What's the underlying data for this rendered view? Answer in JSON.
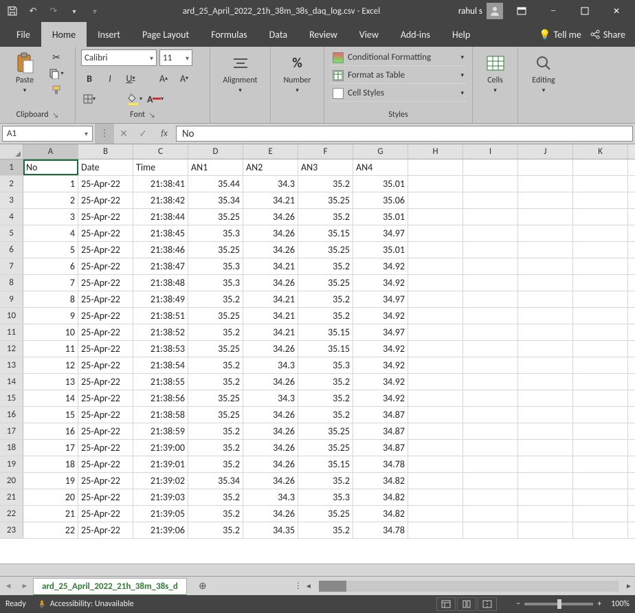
{
  "title": "ard_25_April_2022_21h_38m_38s_daq_log.csv - Excel",
  "user": "rahul s",
  "tabs": [
    "File",
    "Home",
    "Insert",
    "Page Layout",
    "Formulas",
    "Data",
    "Review",
    "View",
    "Add-ins",
    "Help"
  ],
  "tellme": "Tell me",
  "share": "Share",
  "clipboard": {
    "label": "Clipboard",
    "paste": "Paste"
  },
  "font": {
    "label": "Font",
    "name": "Calibri",
    "size": "11"
  },
  "alignment": {
    "label": "Alignment"
  },
  "number": {
    "label": "Number",
    "symbol": "%"
  },
  "styles": {
    "label": "Styles",
    "cond": "Conditional Formatting",
    "table": "Format as Table",
    "cell": "Cell Styles"
  },
  "cells": {
    "label": "Cells"
  },
  "editing": {
    "label": "Editing"
  },
  "namebox": "A1",
  "formula": "No",
  "columns": [
    "A",
    "B",
    "C",
    "D",
    "E",
    "F",
    "G",
    "H",
    "I",
    "J",
    "K"
  ],
  "headers": [
    "No",
    "Date",
    "Time",
    "AN1",
    "AN2",
    "AN3",
    "AN4"
  ],
  "rows": [
    [
      1,
      "25-Apr-22",
      "21:38:41",
      35.44,
      34.3,
      35.2,
      35.01
    ],
    [
      2,
      "25-Apr-22",
      "21:38:42",
      35.34,
      34.21,
      35.25,
      35.06
    ],
    [
      3,
      "25-Apr-22",
      "21:38:44",
      35.25,
      34.26,
      35.2,
      35.01
    ],
    [
      4,
      "25-Apr-22",
      "21:38:45",
      35.3,
      34.26,
      35.15,
      34.97
    ],
    [
      5,
      "25-Apr-22",
      "21:38:46",
      35.25,
      34.26,
      35.25,
      35.01
    ],
    [
      6,
      "25-Apr-22",
      "21:38:47",
      35.3,
      34.21,
      35.2,
      34.92
    ],
    [
      7,
      "25-Apr-22",
      "21:38:48",
      35.3,
      34.26,
      35.25,
      34.92
    ],
    [
      8,
      "25-Apr-22",
      "21:38:49",
      35.2,
      34.21,
      35.2,
      34.97
    ],
    [
      9,
      "25-Apr-22",
      "21:38:51",
      35.25,
      34.21,
      35.2,
      34.92
    ],
    [
      10,
      "25-Apr-22",
      "21:38:52",
      35.2,
      34.21,
      35.15,
      34.97
    ],
    [
      11,
      "25-Apr-22",
      "21:38:53",
      35.25,
      34.26,
      35.15,
      34.92
    ],
    [
      12,
      "25-Apr-22",
      "21:38:54",
      35.2,
      34.3,
      35.3,
      34.92
    ],
    [
      13,
      "25-Apr-22",
      "21:38:55",
      35.2,
      34.26,
      35.2,
      34.92
    ],
    [
      14,
      "25-Apr-22",
      "21:38:56",
      35.25,
      34.3,
      35.2,
      34.92
    ],
    [
      15,
      "25-Apr-22",
      "21:38:58",
      35.25,
      34.26,
      35.2,
      34.87
    ],
    [
      16,
      "25-Apr-22",
      "21:38:59",
      35.2,
      34.26,
      35.25,
      34.87
    ],
    [
      17,
      "25-Apr-22",
      "21:39:00",
      35.2,
      34.26,
      35.25,
      34.87
    ],
    [
      18,
      "25-Apr-22",
      "21:39:01",
      35.2,
      34.26,
      35.15,
      34.78
    ],
    [
      19,
      "25-Apr-22",
      "21:39:02",
      35.34,
      34.26,
      35.2,
      34.82
    ],
    [
      20,
      "25-Apr-22",
      "21:39:03",
      35.2,
      34.3,
      35.3,
      34.82
    ],
    [
      21,
      "25-Apr-22",
      "21:39:05",
      35.2,
      34.26,
      35.25,
      34.82
    ],
    [
      22,
      "25-Apr-22",
      "21:39:06",
      35.2,
      34.35,
      35.2,
      34.78
    ]
  ],
  "sheet_tab": "ard_25_April_2022_21h_38m_38s_d",
  "status": {
    "ready": "Ready",
    "access": "Accessibility: Unavailable",
    "zoom": "100%"
  }
}
